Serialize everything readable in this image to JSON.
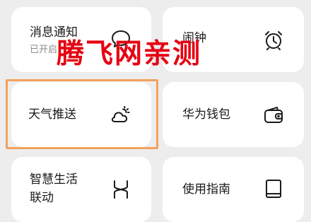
{
  "cards": {
    "notifications": {
      "label": "消息通知",
      "sub": "已开启"
    },
    "alarm": {
      "label": "闹钟"
    },
    "weather": {
      "label": "天气推送"
    },
    "huawei_wallet": {
      "label": "华为钱包"
    },
    "smart_life": {
      "label_line1": "智慧生活",
      "label_line2": "联动"
    },
    "user_guide": {
      "label": "使用指南"
    }
  },
  "watermark": "腾飞网亲测",
  "colors": {
    "background": "#ededed",
    "card": "#ffffff",
    "watermark": "#e60012",
    "highlight_border": "#f3a15c"
  },
  "icons": {
    "notifications": "chat-bubble-icon",
    "alarm": "alarm-clock-icon",
    "weather": "cloud-sun-icon",
    "huawei_wallet": "wallet-icon",
    "smart_life": "link-icon",
    "user_guide": "book-icon"
  }
}
